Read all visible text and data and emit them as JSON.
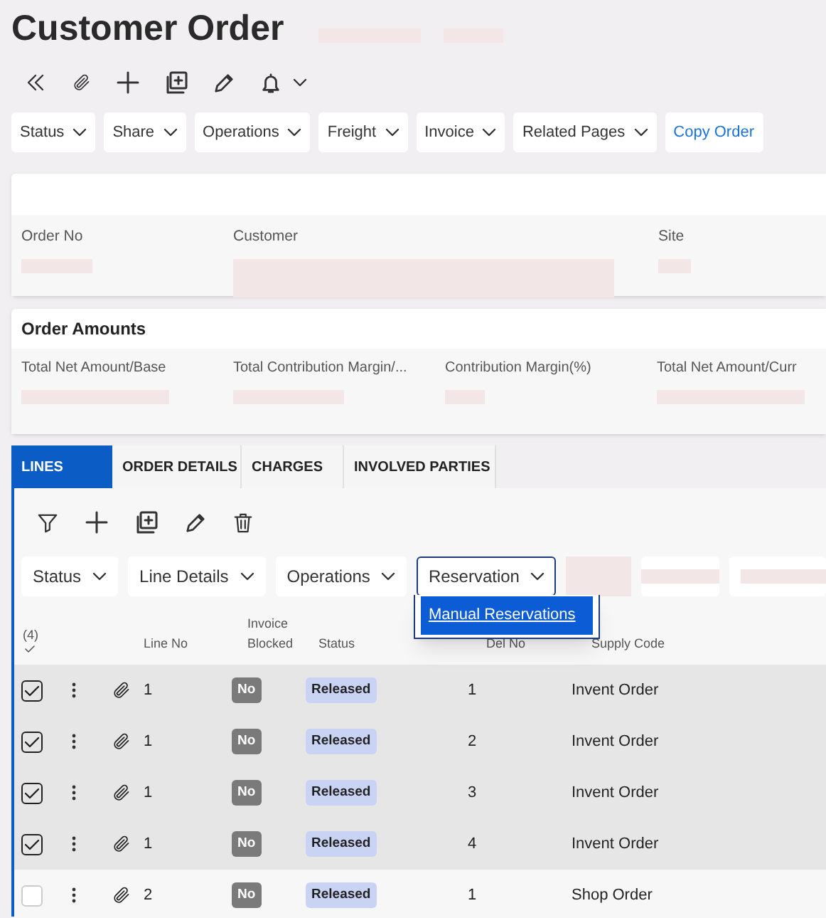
{
  "page": {
    "title": "Customer Order"
  },
  "toolbar_menus": [
    {
      "label": "Status",
      "kind": "menu"
    },
    {
      "label": "Share",
      "kind": "menu"
    },
    {
      "label": "Operations",
      "kind": "menu"
    },
    {
      "label": "Freight",
      "kind": "menu"
    },
    {
      "label": "Invoice",
      "kind": "menu"
    },
    {
      "label": "Related Pages",
      "kind": "menu"
    },
    {
      "label": "Copy Order",
      "kind": "link"
    }
  ],
  "header_card": {
    "fields": [
      {
        "label": "Order No"
      },
      {
        "label": "Customer"
      },
      {
        "label": "Site"
      }
    ]
  },
  "amounts_card": {
    "title": "Order Amounts",
    "fields": [
      {
        "label": "Total Net Amount/Base"
      },
      {
        "label": "Total Contribution Margin/..."
      },
      {
        "label": "Contribution Margin(%)"
      },
      {
        "label": "Total Net Amount/Curr"
      }
    ]
  },
  "tabs": [
    {
      "label": "LINES",
      "selected": true
    },
    {
      "label": "ORDER DETAILS",
      "selected": false
    },
    {
      "label": "CHARGES",
      "selected": false
    },
    {
      "label": "INVOLVED PARTIES",
      "selected": false
    }
  ],
  "line_menus": [
    {
      "label": "Status",
      "expanded": false
    },
    {
      "label": "Line Details",
      "expanded": false
    },
    {
      "label": "Operations",
      "expanded": false
    },
    {
      "label": "Reservation",
      "expanded": true,
      "items": [
        "Manual Reservations"
      ]
    }
  ],
  "table": {
    "selected_count": "(4)",
    "columns": [
      "Line No",
      "Invoice Blocked",
      "Status",
      "Del No",
      "Supply Code"
    ],
    "rows": [
      {
        "checked": true,
        "line_no": "1",
        "invoice_blocked": "No",
        "status": "Released",
        "del_no": "1",
        "supply_code": "Invent Order"
      },
      {
        "checked": true,
        "line_no": "1",
        "invoice_blocked": "No",
        "status": "Released",
        "del_no": "2",
        "supply_code": "Invent Order"
      },
      {
        "checked": true,
        "line_no": "1",
        "invoice_blocked": "No",
        "status": "Released",
        "del_no": "3",
        "supply_code": "Invent Order"
      },
      {
        "checked": true,
        "line_no": "1",
        "invoice_blocked": "No",
        "status": "Released",
        "del_no": "4",
        "supply_code": "Invent Order"
      },
      {
        "checked": false,
        "line_no": "2",
        "invoice_blocked": "No",
        "status": "Released",
        "del_no": "1",
        "supply_code": "Shop Order"
      }
    ]
  }
}
